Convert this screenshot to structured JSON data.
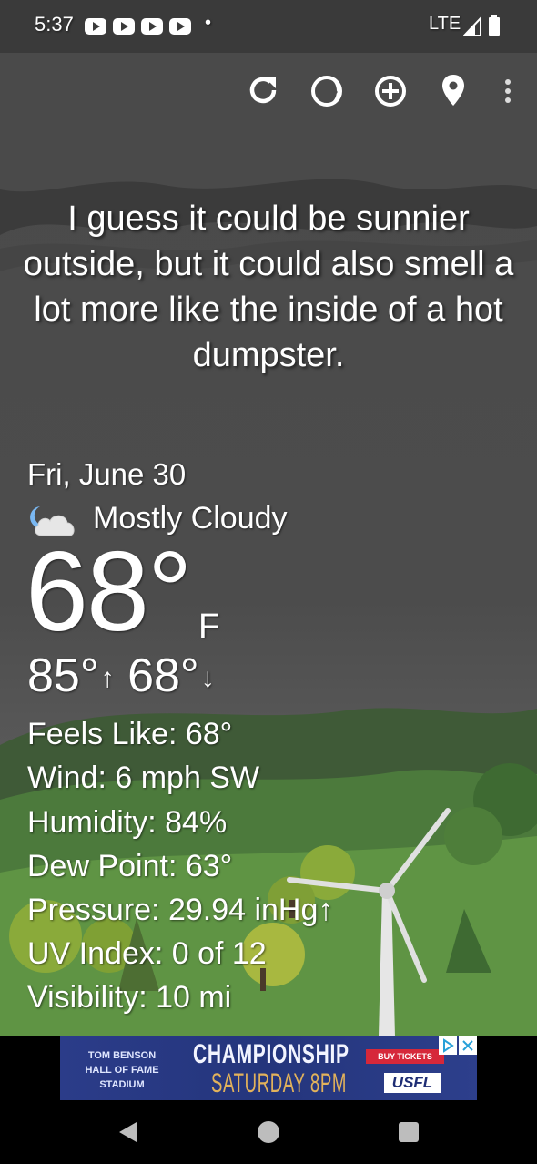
{
  "status_bar": {
    "time": "5:37",
    "dot": "•",
    "network": "LTE"
  },
  "toolbar": {
    "refresh": "refresh-icon",
    "theme": "theme-icon",
    "add_location": "add-location-icon",
    "location": "location-pin-icon",
    "more": "more-vert-icon"
  },
  "quote": "I guess it could be sunnier outside, but it could also smell a lot more like the inside of a hot dumpster.",
  "weather": {
    "date": "Fri, June 30",
    "condition": "Mostly Cloudy",
    "condition_icon": "partly-cloudy-night-icon",
    "temperature": "68°",
    "unit": "F",
    "high": "85°",
    "low": "68°",
    "high_arrow": "↑",
    "low_arrow": "↓",
    "details": [
      {
        "text": "Feels Like:  68°"
      },
      {
        "text": "Wind:  6 mph SW"
      },
      {
        "text": "Humidity:  84%"
      },
      {
        "text": "Dew Point:  63°"
      },
      {
        "text": "Pressure:  29.94 inHg↑"
      },
      {
        "text": "UV Index:  0 of 12"
      },
      {
        "text": "Visibility:  10 mi"
      }
    ]
  },
  "ad": {
    "venue_line1": "TOM BENSON",
    "venue_line2": "HALL OF FAME",
    "venue_line3": "STADIUM",
    "headline": "CHAMPIONSHIP",
    "subline": "SATURDAY 8PM",
    "cta": "BUY TICKETS",
    "brand": "USFL"
  },
  "nav": {
    "back": "back-icon",
    "home": "home-icon",
    "recents": "recents-icon"
  },
  "colors": {
    "background": "#4a4a4a",
    "text": "#ffffff",
    "ad_blue": "#2b3c89",
    "ad_red": "#d6283a",
    "ad_gold": "#e2b25b"
  }
}
